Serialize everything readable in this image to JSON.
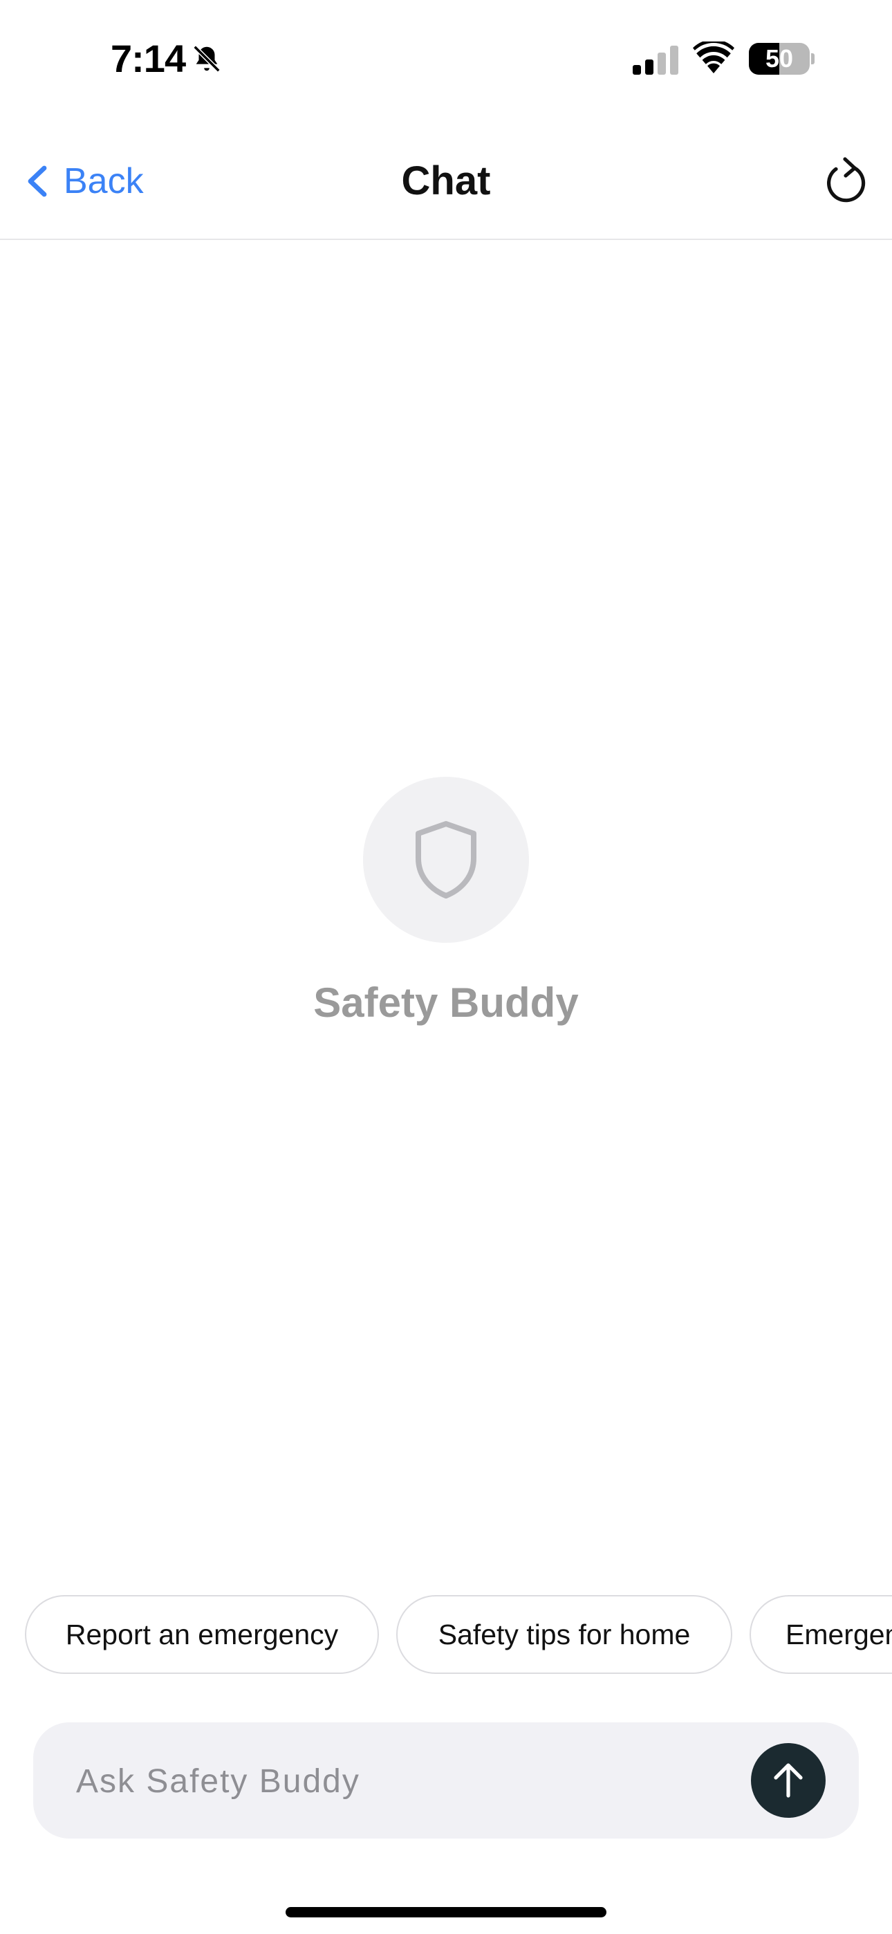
{
  "status_bar": {
    "time": "7:14",
    "battery_level": 50,
    "battery_label": "50",
    "icons": [
      "bell-slash-icon",
      "cellular-signal-icon",
      "wifi-icon",
      "battery-icon"
    ]
  },
  "nav": {
    "back_label": "Back",
    "title": "Chat",
    "icons": [
      "chevron-left-icon",
      "refresh-icon"
    ]
  },
  "empty_state": {
    "icon": "shield-icon",
    "title": "Safety Buddy"
  },
  "suggestions": [
    {
      "label": "Report an emergency"
    },
    {
      "label": "Safety tips for home"
    },
    {
      "label": "Emergen"
    }
  ],
  "composer": {
    "placeholder": "Ask Safety Buddy",
    "value": "",
    "send_icon": "arrow-up-icon"
  },
  "colors": {
    "accent": "#3b82f6",
    "send_button": "#1b2a30",
    "muted_text": "#9a9a9a",
    "composer_bg": "#f1f1f5"
  }
}
